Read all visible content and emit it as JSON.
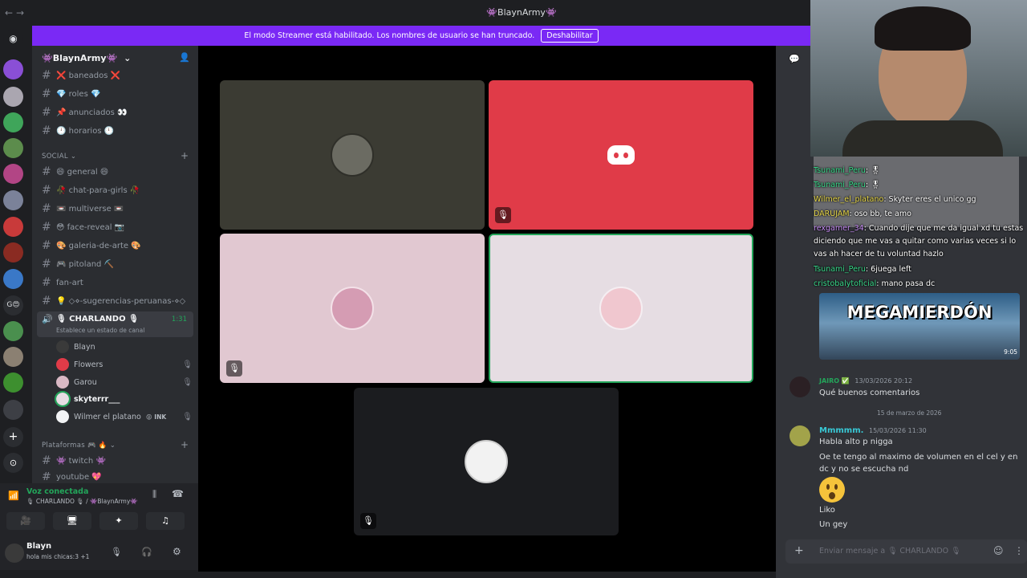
{
  "titlebar": {
    "back": "←",
    "forward": "→",
    "title": "👾BlaynArmy👾"
  },
  "banner": {
    "text": "El modo Streamer está habilitado. Los nombres de usuario se han truncado.",
    "button": "Deshabilitar"
  },
  "server": {
    "name": "👾BlaynArmy👾"
  },
  "channels_top": [
    {
      "label": "❌ baneados ❌"
    },
    {
      "label": "💎 roles 💎"
    },
    {
      "label": "📌 anunciados 👀"
    },
    {
      "label": "🕛 horarios 🕛"
    }
  ],
  "category_social": "SOCIAL",
  "channels_social": [
    {
      "label": "😄 general 😄"
    },
    {
      "label": "🥀 chat-para-girls 🥀"
    },
    {
      "label": "📼 multiverse 📼"
    },
    {
      "label": "😳 face-reveal 📷"
    },
    {
      "label": "🎨 galeria-de-arte 🎨"
    },
    {
      "label": "🎮 pitoland ⛏️"
    },
    {
      "label": "fan-art"
    },
    {
      "label": "💡 ◇⋄-sugerencias-peruanas-⋄◇"
    }
  ],
  "voice_channel": {
    "label": "🎙 CHARLANDO 🎙",
    "timer": "1:31",
    "status": "Establece un estado de canal"
  },
  "voice_users": [
    {
      "name": "Blayn",
      "muted": false
    },
    {
      "name": "Flowers",
      "muted": true
    },
    {
      "name": "Garou",
      "muted": true
    },
    {
      "name": "skyterrr___",
      "muted": false
    },
    {
      "name": "Wilmer el platano",
      "badge": "😝 INK",
      "muted": true
    }
  ],
  "category_plataformas": "Plataformas 🎮 🔥",
  "channels_plataformas": [
    {
      "label": "👾 twitch 👾"
    },
    {
      "label": "youtube 💖"
    }
  ],
  "voice_panel": {
    "status": "Voz conectada",
    "location": "🎙 CHARLANDO 🎙 / 👾BlaynArmy👾"
  },
  "user_panel": {
    "name": "Blayn",
    "status": "hola mis chicas:3 +1"
  },
  "stream_chat": [
    {
      "user": "Tsunami_Peru",
      "text": ": 🎖"
    },
    {
      "user": "Tsunami_Peru",
      "text": ": 🎖"
    },
    {
      "user": "Wilmer_el_platano",
      "text": ": Skyter eres el unico gg"
    },
    {
      "user": "DARUJAM",
      "text": ": oso bb, te amo"
    },
    {
      "user": "rexgamer_34",
      "text": ": Cuando dije que me da igual xd tu estas diciendo que me vas a quitar como varias veces si lo vas ah hacer de tu voluntad hazlo"
    },
    {
      "user": "Tsunami_Peru",
      "text": ": 6juega left"
    },
    {
      "user": "cristobalytoficial",
      "text": ": mano pasa dc"
    }
  ],
  "video_card": {
    "title": "MEGAMIERDÓN",
    "duration": "9:05"
  },
  "messages": [
    {
      "author": "JAIRO ✅",
      "time": "13/03/2026 20:12",
      "lines": [
        "Qué buenos comentarios"
      ]
    },
    {
      "divider": "15 de marzo de 2026"
    },
    {
      "author": "Mmmmm.",
      "time": "15/03/2026 11:30",
      "lines": [
        "Habla alto p nigga",
        "Oe te tengo al maximo de volumen en el cel y en dc y no se escucha nd"
      ],
      "after": [
        "Liko",
        "Un gey"
      ]
    }
  ],
  "composer": {
    "placeholder": "Enviar mensaje a 🎙 CHARLANDO 🎙"
  },
  "colors": {
    "accent": "#7a29f5",
    "discord_red": "#e03b48",
    "speaking": "#23a55a"
  }
}
